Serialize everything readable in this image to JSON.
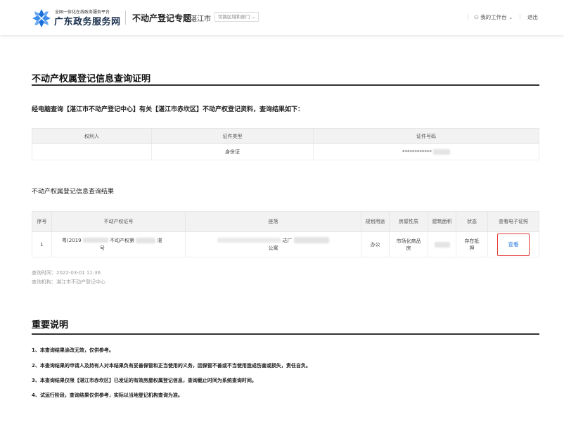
{
  "header": {
    "logo_small": "全国一体化在线政务服务平台",
    "logo_big": "广东政务服务网",
    "topic": "不动产登记专题",
    "city": "湛江市",
    "switch_label": "切换区域和部门",
    "workbench": "我的工作台",
    "logout": "退出",
    "brand_color": "#1a6fd9"
  },
  "page": {
    "title": "不动产权属登记信息查询证明",
    "intro": "经电脑查询【湛江市不动产登记中心】有关【湛江市赤坎区】不动产权登记资料，查询结果如下："
  },
  "owner_table": {
    "headers": [
      "权利人",
      "证件类型",
      "证件号码"
    ],
    "rows": [
      {
        "owner": "",
        "id_type": "身份证",
        "id_number": "************"
      }
    ]
  },
  "result": {
    "title": "不动产权属登记信息查询结果",
    "headers": {
      "seq": "序号",
      "cert_no": "不动产权证号",
      "location": "座落",
      "usage": "规划用途",
      "nature": "房屋性质",
      "area": "建筑面积",
      "status": "状态",
      "view": "查看电子证照"
    },
    "rows": [
      {
        "seq": "1",
        "cert_line1a": "粤(2019",
        "cert_line1b": "不动产权第",
        "cert_line1c": "湛",
        "cert_line2": "号",
        "loc_line1": "达广",
        "loc_line2": "公寓",
        "usage": "办公",
        "nature_line1": "市场化商品",
        "nature_line2": "房",
        "area": "",
        "status_line1": "存在抵",
        "status_line2": "押",
        "view_label": "查看"
      }
    ]
  },
  "meta": {
    "query_time": "查询时间：2022-03-01 11:36",
    "query_org": "查询机构：湛江市不动产登记中心"
  },
  "notes": {
    "title": "重要说明",
    "items": [
      "1、本查询结果涂改无效，仅供参考。",
      "2、本查询结果的申请人及持有人对本结果负有妥善保管和正当使用的义务，因保管不善或不当使用造成伤害或损失，责任自负。",
      "3、本查询结果仅限【湛江市赤坎区】已发证的有效房屋权属登记信息，查询截止时间为系统查询时间。",
      "4、试运行阶段，查询结果仅供参考，实际以当地登记机构查询为准。"
    ]
  }
}
